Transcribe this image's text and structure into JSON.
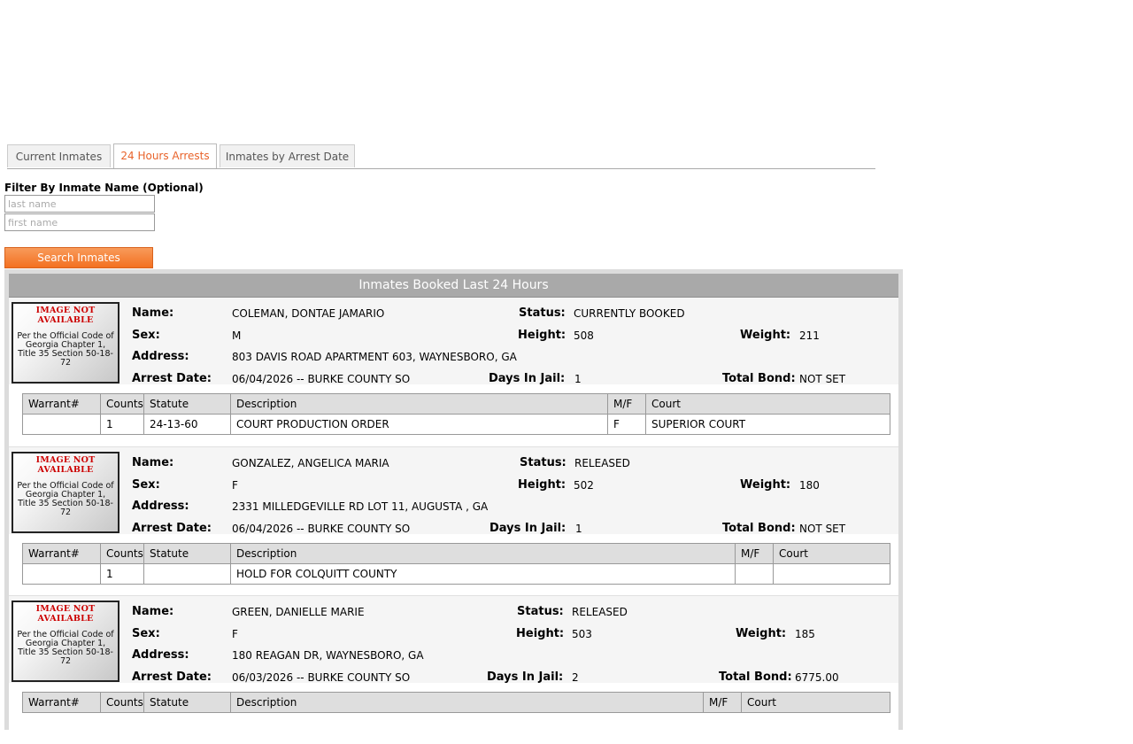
{
  "tabs": [
    {
      "label": "Current Inmates",
      "active": false
    },
    {
      "label": "24 Hours Arrests",
      "active": true
    },
    {
      "label": "Inmates by Arrest Date",
      "active": false
    }
  ],
  "filter": {
    "label": "Filter By Inmate Name (Optional)",
    "last_name_placeholder": "last name",
    "first_name_placeholder": "first name",
    "search_button": "Search Inmates"
  },
  "panel": {
    "title": "Inmates Booked Last 24 Hours"
  },
  "labels": {
    "name": "Name:",
    "sex": "Sex:",
    "address": "Address:",
    "arrest_date": "Arrest Date:",
    "status": "Status:",
    "height": "Height:",
    "weight": "Weight:",
    "days_in_jail": "Days In Jail:",
    "total_bond": "Total Bond:"
  },
  "photo": {
    "not_available": "IMAGE NOT AVAILABLE",
    "code_text": "Per the Official Code of Georgia Chapter 1, Title 35 Section 50-18-72"
  },
  "charge_columns": [
    "Warrant#",
    "Counts",
    "Statute",
    "Description",
    "M/F",
    "Court"
  ],
  "accent_colors": {
    "active_tab": "#e8632b",
    "button": "#f37021",
    "header": "#a9a9a9"
  },
  "inmates": [
    {
      "name": "COLEMAN, DONTAE JAMARIO",
      "sex": "M",
      "address": "803 DAVIS ROAD APARTMENT 603, WAYNESBORO, GA",
      "arrest_date": "06/04/2026 -- BURKE COUNTY SO",
      "status": "CURRENTLY BOOKED",
      "height": "508",
      "weight": "211",
      "days_in_jail": "1",
      "total_bond": "NOT SET",
      "charges": [
        {
          "warrant": "",
          "counts": "1",
          "statute": "24-13-60",
          "description": "COURT PRODUCTION ORDER",
          "mf": "F",
          "court": "SUPERIOR COURT"
        }
      ]
    },
    {
      "name": "GONZALEZ, ANGELICA MARIA",
      "sex": "F",
      "address": "2331 MILLEDGEVILLE RD LOT 11, AUGUSTA , GA",
      "arrest_date": "06/04/2026 -- BURKE COUNTY SO",
      "status": "RELEASED",
      "height": "502",
      "weight": "180",
      "days_in_jail": "1",
      "total_bond": "NOT SET",
      "charges": [
        {
          "warrant": "",
          "counts": "1",
          "statute": "",
          "description": "HOLD FOR COLQUITT COUNTY",
          "mf": "",
          "court": ""
        }
      ]
    },
    {
      "name": "GREEN, DANIELLE MARIE",
      "sex": "F",
      "address": "180 REAGAN DR, WAYNESBORO, GA",
      "arrest_date": "06/03/2026 -- BURKE COUNTY SO",
      "status": "RELEASED",
      "height": "503",
      "weight": "185",
      "days_in_jail": "2",
      "total_bond": "6775.00",
      "charges": []
    }
  ]
}
